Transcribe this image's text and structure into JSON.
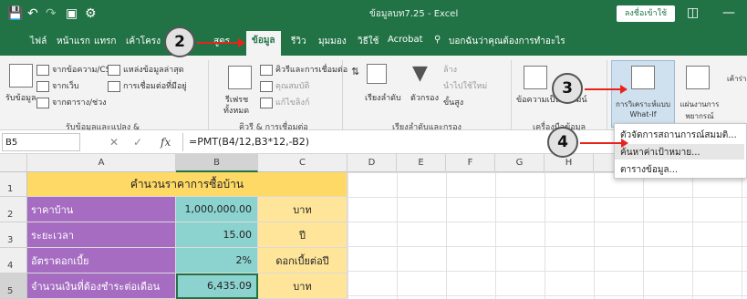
{
  "titlebar": {
    "title": "ข้อมูลบท7.25 - Excel",
    "signin": "ลงชื่อเข้าใช้"
  },
  "tabs": [
    {
      "label": "ไฟล์"
    },
    {
      "label": "หน้าแรก"
    },
    {
      "label": "แทรก"
    },
    {
      "label": "เค้าโครง"
    },
    {
      "label": "สูตร"
    },
    {
      "label": "ข้อมูล"
    },
    {
      "label": "รีวิว"
    },
    {
      "label": "มุมมอง"
    },
    {
      "label": "วิธีใช้"
    },
    {
      "label": "Acrobat"
    },
    {
      "label": "บอกฉันว่าคุณต้องการทำอะไร"
    }
  ],
  "ribbon": {
    "get_data": "รับข้อมูล",
    "from_text": "จากข้อความ/CSV",
    "from_web": "จากเว็บ",
    "from_table": "จากตาราง/ช่วง",
    "recent_sources": "แหล่งข้อมูลล่าสุด",
    "existing_conn": "การเชื่อมต่อที่มีอยู่",
    "group_get": "รับข้อมูลและแปลง &",
    "refresh": "รีเฟรช",
    "refresh_all": "ทั้งหมด",
    "queries": "คิวรีและการเชื่อมต่อ",
    "properties": "คุณสมบัติ",
    "edit_links": "แก้ไขลิงก์",
    "group_queries": "คิวรี & การเชื่อมต่อ",
    "sort": "เรียงลำดับ",
    "filter": "ตัวกรอง",
    "clear": "ล้าง",
    "reapply": "นำไปใช้ใหม่",
    "advanced": "ขั้นสูง",
    "group_sort": "เรียงลำดับและกรอง",
    "text_to_col": "ข้อความเป็นคอลัมน์",
    "group_tools": "เครื่องมือข้อมูล",
    "whatif": "การวิเคราะห์แบบ What-If",
    "forecast": "แผ่นงานการพยากรณ์",
    "outline": "เค้าร่าง"
  },
  "formula_bar": {
    "name_box": "B5",
    "formula": "=PMT(B4/12,B3*12,-B2)",
    "fx": "fx"
  },
  "columns": [
    "A",
    "B",
    "C",
    "D",
    "E",
    "F",
    "G",
    "H",
    "I",
    "J"
  ],
  "rows": [
    {
      "num": "1",
      "title": "คำนวนราคาการซื้อบ้าน"
    },
    {
      "num": "2",
      "a": "ราคาบ้าน",
      "b": "1,000,000.00",
      "c": "บาท"
    },
    {
      "num": "3",
      "a": "ระยะเวลา",
      "b": "15.00",
      "c": "ปี"
    },
    {
      "num": "4",
      "a": "อัตราดอกเบี้ย",
      "b": "2%",
      "c": "ดอกเบี้ยต่อปี"
    },
    {
      "num": "5",
      "a": "จำนวนเงินที่ต้องชำระต่อเดือน",
      "b": "6,435.09",
      "c": "บาท"
    }
  ],
  "whatif_menu": [
    {
      "label": "ตัวจัดการสถานการณ์สมมติ..."
    },
    {
      "label": "ค้นหาค่าเป้าหมาย..."
    },
    {
      "label": "ตารางข้อมูล..."
    }
  ],
  "callouts": [
    "2",
    "3",
    "4"
  ],
  "colors": {
    "excel_green": "#217346",
    "callout_arrow": "#e8231b"
  }
}
